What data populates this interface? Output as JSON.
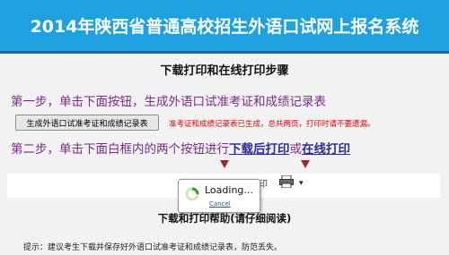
{
  "header": {
    "title": "2014年陕西省普通高校招生外语口试网上报名系统"
  },
  "main": {
    "section_title": "下载打印和在线打印步骤",
    "step1_text": "第一步，单击下面按钮，生成外语口试准考证和成绩记录表",
    "generate_button_label": "生成外语口试准考证和成绩记录表",
    "status_message": "准考证和成绩记录表已生成，总共两页，打印时请不要遗漏。",
    "step2_prefix": "第二步，单击下面白框内的两个按钮进行",
    "download_print_link": "下载后打印",
    "step2_connector": "或",
    "online_print_link": "在线打印",
    "frame_label": "下载打印",
    "loading_text": "Loading...",
    "cancel_link": "Cancel",
    "help_title": "下载和打印帮助(请仔细阅读)",
    "tip_text": "提示：建议考生下载并保存好外语口试准考证和成绩记录表，防范丢失。"
  },
  "icons": {
    "printer": "printer-icon",
    "arrow": "down-arrow-icon",
    "dropdown": "chevron-down-icon",
    "spinner": "loading-spinner-icon"
  },
  "colors": {
    "banner": "#1da1e0",
    "step_text": "#7b2a8a",
    "link": "#2b2b9a",
    "status": "#e00000",
    "arrow": "#a0282a"
  }
}
